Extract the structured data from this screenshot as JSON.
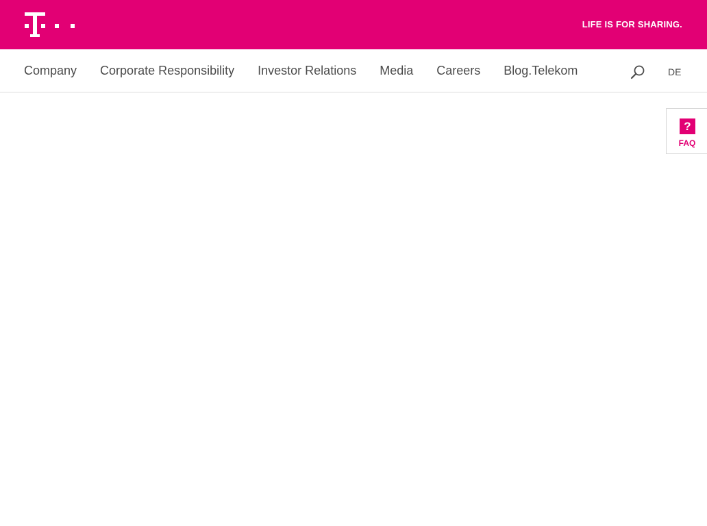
{
  "brand": {
    "logo_icon": "telekom-t-logo-icon",
    "slogan": "LIFE IS FOR SHARING.",
    "colors": {
      "magenta": "#e20074",
      "white": "#ffffff",
      "nav_text": "#4b4b4b",
      "divider": "#dcdcdc"
    }
  },
  "nav": {
    "items": [
      {
        "label": "Company"
      },
      {
        "label": "Corporate Responsibility"
      },
      {
        "label": "Investor Relations"
      },
      {
        "label": "Media"
      },
      {
        "label": "Careers"
      },
      {
        "label": "Blog.Telekom"
      }
    ],
    "search_icon": "search-icon",
    "language": "DE"
  },
  "faq": {
    "icon_glyph": "?",
    "label": "FAQ"
  }
}
